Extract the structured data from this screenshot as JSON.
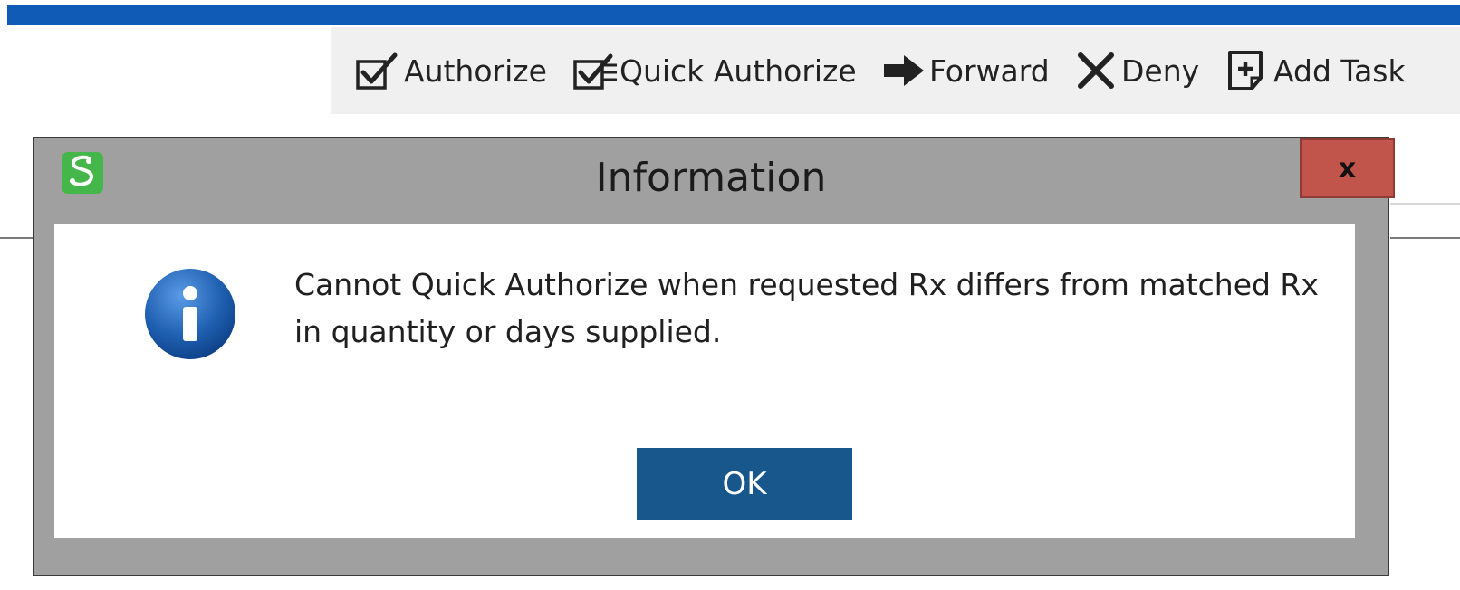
{
  "toolbar": {
    "buttons": [
      {
        "label": "Authorize",
        "icon": "checkbox-check-icon"
      },
      {
        "label": "Quick Authorize",
        "icon": "checklist-icon"
      },
      {
        "label": "Forward",
        "icon": "right-arrow-icon"
      },
      {
        "label": "Deny",
        "icon": "x-icon"
      },
      {
        "label": "Add Task",
        "icon": "add-task-icon"
      }
    ]
  },
  "dialog": {
    "title": "Information",
    "close_label": "x",
    "message": "Cannot Quick Authorize when requested Rx differs from matched Rx in quantity or days supplied.",
    "ok_label": "OK",
    "icons": {
      "app": "app-logo-icon",
      "info": "info-icon"
    }
  },
  "colors": {
    "top_bar": "#0f5bb5",
    "toolbar_bg": "#f0f0f0",
    "dialog_frame": "#a0a0a0",
    "close_button": "#c1554b",
    "ok_button": "#17578c",
    "app_icon": "#45b649",
    "info_icon": "#1f5fb0"
  }
}
